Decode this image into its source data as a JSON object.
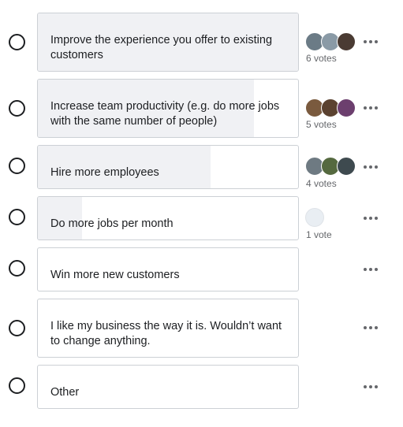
{
  "poll": {
    "options": [
      {
        "label": "Improve the experience you offer to existing customers",
        "votes_text": "6 votes",
        "result_fraction": 1.0,
        "avatar_colors": [
          "#6b7b86",
          "#8a9aa6",
          "#4a3b33"
        ]
      },
      {
        "label": "Increase team productivity (e.g. do more jobs with the same number of people)",
        "votes_text": "5 votes",
        "result_fraction": 0.83,
        "avatar_colors": [
          "#7a5a3e",
          "#5b4230",
          "#6c3f6e"
        ]
      },
      {
        "label": "Hire more employees",
        "votes_text": "4 votes",
        "result_fraction": 0.665,
        "avatar_colors": [
          "#6e7a82",
          "#55693f",
          "#3e4a4f"
        ]
      },
      {
        "label": "Do more jobs per month",
        "votes_text": "1 vote",
        "result_fraction": 0.17,
        "avatar_colors": [
          "#e9eef3"
        ]
      },
      {
        "label": "Win more new customers",
        "votes_text": "",
        "result_fraction": 0.0,
        "avatar_colors": []
      },
      {
        "label": "I like my business the way it is. Wouldn’t want to change anything.",
        "votes_text": "",
        "result_fraction": 0.0,
        "avatar_colors": []
      },
      {
        "label": "Other",
        "votes_text": "",
        "result_fraction": 0.0,
        "avatar_colors": []
      }
    ],
    "icons": {
      "radio": "radio-unselected-icon",
      "more": "more-options-icon"
    }
  }
}
